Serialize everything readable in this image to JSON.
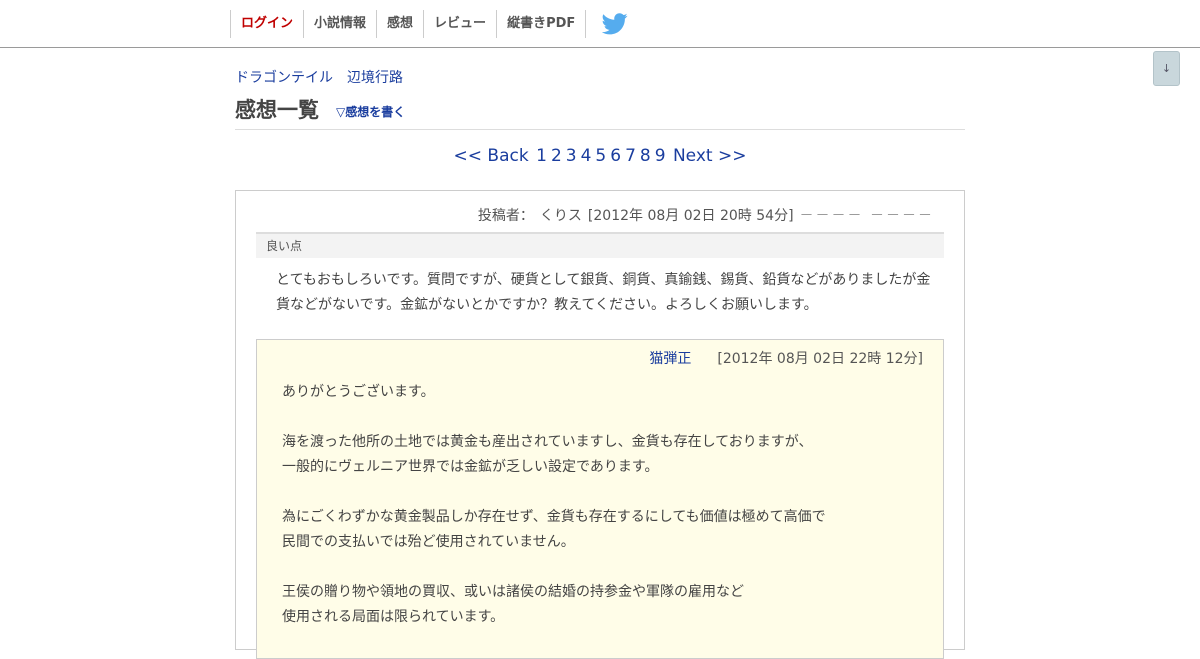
{
  "nav": {
    "items": [
      {
        "id": "login",
        "label": "ログイン"
      },
      {
        "id": "novel-info",
        "label": "小説情報"
      },
      {
        "id": "impressions",
        "label": "感想"
      },
      {
        "id": "reviews",
        "label": "レビュー"
      },
      {
        "id": "vertical-pdf",
        "label": "縦書きPDF"
      }
    ],
    "twitter_icon": "twitter-bird-icon",
    "accent_color": "#c00000",
    "twitter_color": "#55acee"
  },
  "scroll_button": {
    "label": "↓"
  },
  "header": {
    "novel_title": "ドラゴンテイル",
    "author": "辺境行路",
    "page_title": "感想一覧",
    "write_link": "▽感想を書く"
  },
  "pager": {
    "back": "<< Back",
    "pages": [
      "1",
      "2",
      "3",
      "4",
      "5",
      "6",
      "7",
      "8",
      "9"
    ],
    "next": "Next >>"
  },
  "review": {
    "poster_label": "投稿者：",
    "poster_name": "くりス",
    "date": "[2012年 08月 02日 20時 54分]",
    "dashes": "－－－－ －－－－",
    "section_label": "良い点",
    "body": "とてもおもしろいです。質問ですが、硬貨として銀貨、銅貨、真鍮銭、錫貨、鉛貨などがありましたが金貨などがないです。金鉱がないとかですか？教えてください。よろしくお願いします。",
    "reply": {
      "author": "猫弾正",
      "date": "[2012年 08月 02日 22時 12分]",
      "lines": [
        "ありがとうございます。",
        "",
        "海を渡った他所の土地では黄金も産出されていますし、金貨も存在しておりますが、",
        "一般的にヴェルニア世界では金鉱が乏しい設定であります。",
        "",
        "為にごくわずかな黄金製品しか存在せず、金貨も存在するにしても価値は極めて高価で",
        "民間での支払いでは殆ど使用されていません。",
        "",
        "王侯の贈り物や領地の買収、或いは諸侯の結婚の持参金や軍隊の雇用など",
        "使用される局面は限られています。"
      ]
    }
  },
  "colors": {
    "link": "#1a3d9e",
    "reply_background": "#fffde8"
  }
}
